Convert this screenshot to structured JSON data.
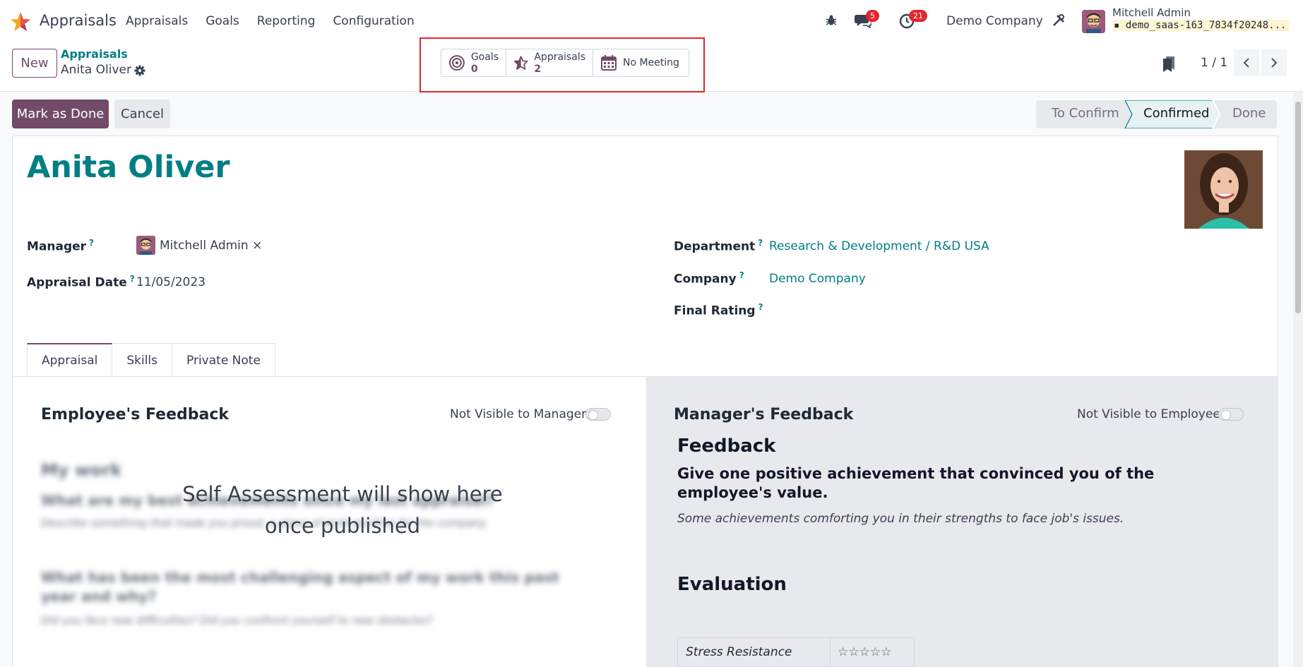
{
  "app": {
    "name": "Appraisals"
  },
  "menu": [
    "Appraisals",
    "Goals",
    "Reporting",
    "Configuration"
  ],
  "systray": {
    "messages_count": "5",
    "activities_count": "21",
    "company": "Demo Company",
    "user_name": "Mitchell Admin",
    "database": "demo_saas-163_7834f20248..."
  },
  "control": {
    "new_label": "New",
    "breadcrumb_parent": "Appraisals",
    "breadcrumb_current": "Anita Oliver",
    "pager": "1 / 1"
  },
  "stat_buttons": {
    "goals_label": "Goals",
    "goals_value": "0",
    "appraisals_label": "Appraisals",
    "appraisals_value": "2",
    "meeting_label": "No Meeting"
  },
  "actions": {
    "mark_done": "Mark as Done",
    "cancel": "Cancel"
  },
  "status": {
    "stages": [
      "To Confirm",
      "Confirmed",
      "Done"
    ],
    "current": "Confirmed"
  },
  "form": {
    "employee_name": "Anita Oliver",
    "manager_label": "Manager",
    "manager_value": "Mitchell Admin",
    "remove_mark": "×",
    "help_mark": "?",
    "date_label": "Appraisal Date",
    "date_value": "11/05/2023",
    "department_label": "Department",
    "department_value": "Research & Development / R&D USA",
    "company_label": "Company",
    "company_value": "Demo Company",
    "rating_label": "Final Rating"
  },
  "tabs": [
    "Appraisal",
    "Skills",
    "Private Note"
  ],
  "employee_feedback": {
    "title": "Employee's Feedback",
    "toggle_label": "Not Visible to Manager",
    "overlay": "Self Assessment will show here once published",
    "blurred_h": "My work",
    "blurred_q1": "What are my best achievements since my last appraisal?",
    "blurred_d1": "Describe something that made you proud, a piece of work positive for the company.",
    "blurred_q2": "What has been the most challenging aspect of my work this past year and why?",
    "blurred_d2": "Did you face new difficulties? Did you confront yourself to new obstacles?"
  },
  "manager_feedback": {
    "title": "Manager's Feedback",
    "toggle_label": "Not Visible to Employee",
    "feedback_heading": "Feedback",
    "question": "Give one positive achievement that convinced you of the employee's value.",
    "hint": "Some achievements comforting you in their strengths to face job's issues.",
    "evaluation_heading": "Evaluation",
    "eval_row_label": "Stress Resistance",
    "eval_row_stars": "☆☆☆☆☆"
  },
  "colors": {
    "brand": "#714b67",
    "link": "#017e84",
    "badge": "#e3262f",
    "highlight": "#e3262f"
  }
}
